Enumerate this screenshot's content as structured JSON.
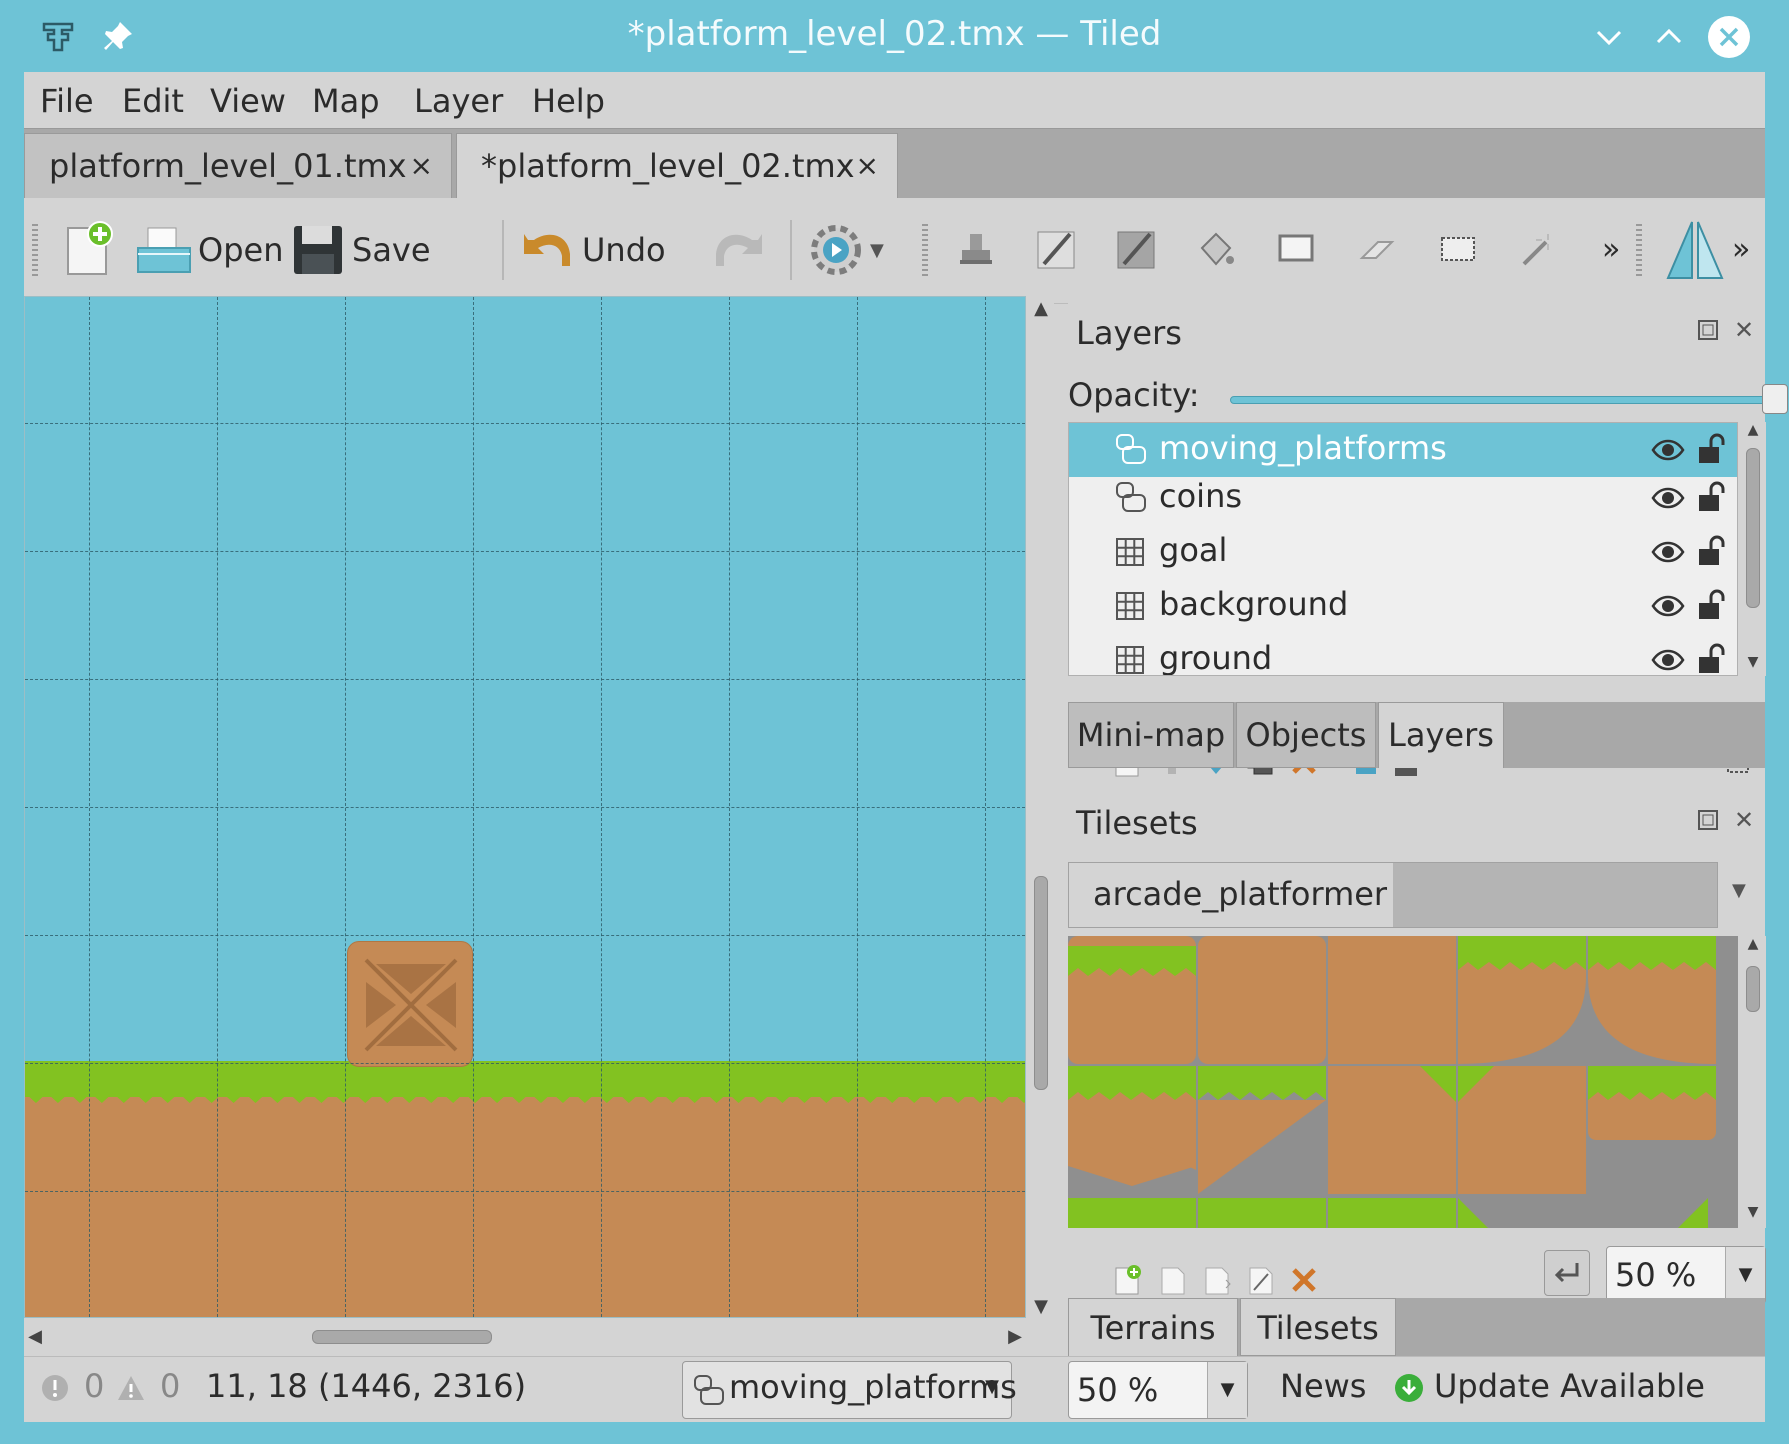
{
  "window": {
    "title": "*platform_level_02.tmx — Tiled",
    "app_icon": "tiled-app-icon",
    "pin_icon": "pin-icon",
    "buttons": [
      "minimize",
      "maximize",
      "close"
    ]
  },
  "menu": {
    "file": "File",
    "edit": "Edit",
    "view": "View",
    "map": "Map",
    "layer": "Layer",
    "help": "Help"
  },
  "tabs": [
    {
      "label": "platform_level_01.tmx",
      "close": "×"
    },
    {
      "label": "*platform_level_02.tmx",
      "close": "×",
      "active": true
    }
  ],
  "toolbar": {
    "open": "Open",
    "save": "Save",
    "undo": "Undo",
    "overflow": "»"
  },
  "layers_panel": {
    "title": "Layers",
    "opacity_label": "Opacity:",
    "opacity": 1.0,
    "layers": [
      {
        "name": "moving_platforms",
        "type": "object",
        "selected": true
      },
      {
        "name": "coins",
        "type": "object"
      },
      {
        "name": "goal",
        "type": "tile"
      },
      {
        "name": "background",
        "type": "tile"
      },
      {
        "name": "ground",
        "type": "tile"
      }
    ]
  },
  "dock_tabs_top": [
    "Mini-map",
    "Objects",
    "Layers"
  ],
  "tilesets_panel": {
    "title": "Tilesets",
    "tileset_name": "arcade_platformer",
    "zoom": "50 %"
  },
  "dock_tabs_bottom": [
    "Terrains",
    "Tilesets"
  ],
  "status": {
    "errors": "0",
    "warnings": "0",
    "coords": "11, 18 (1446, 2316)",
    "current_layer": "moving_platforms",
    "zoom": "50 %",
    "news": "News",
    "update": "Update Available"
  },
  "colors": {
    "accent": "#6ec3d6",
    "grass": "#82c221",
    "dirt": "#c58a55",
    "chrome": "#d4d4d4"
  }
}
